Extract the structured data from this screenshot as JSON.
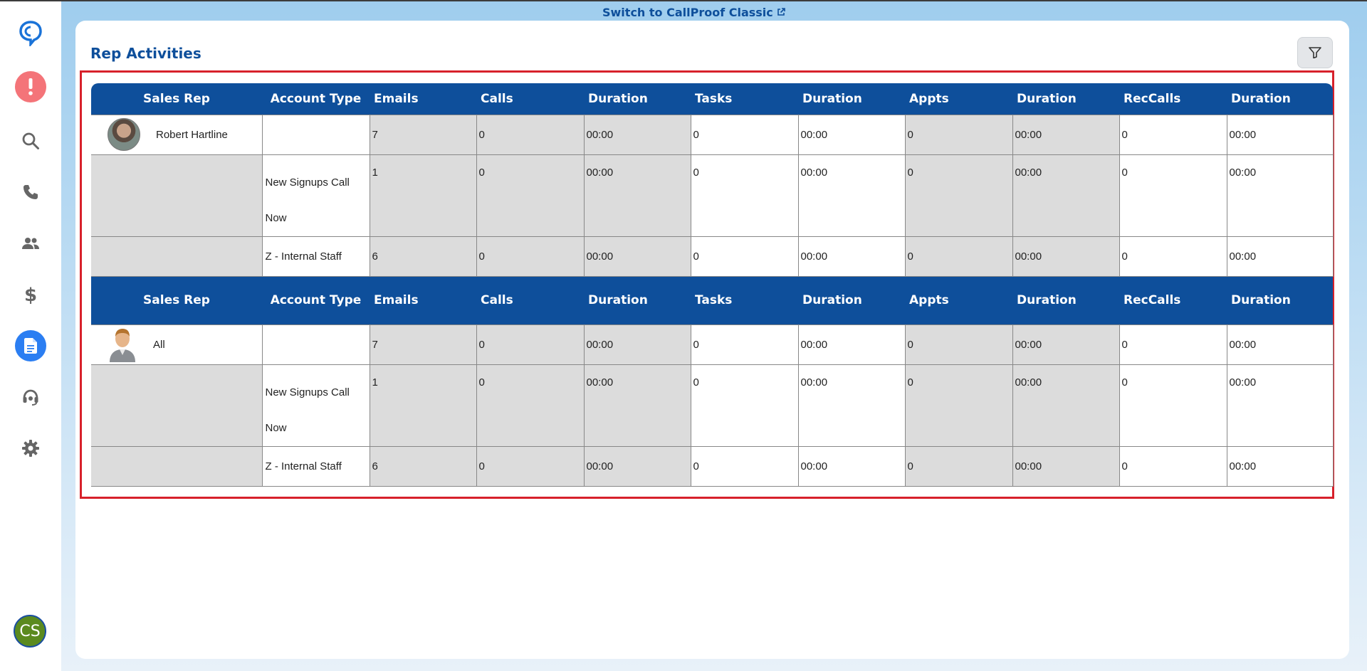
{
  "topbar": {
    "switch_label": "Switch to CallProof Classic"
  },
  "sidebar": {
    "items": [
      {
        "name": "logo",
        "icon": "callproof-logo-icon"
      },
      {
        "name": "alerts",
        "icon": "alert-icon",
        "color": "#f47479"
      },
      {
        "name": "search",
        "icon": "search-icon"
      },
      {
        "name": "calls",
        "icon": "phone-icon"
      },
      {
        "name": "contacts",
        "icon": "people-icon"
      },
      {
        "name": "sales",
        "icon": "dollar-icon"
      },
      {
        "name": "reports",
        "icon": "document-icon",
        "color": "#2b7ef2"
      },
      {
        "name": "support",
        "icon": "headset-icon"
      },
      {
        "name": "settings",
        "icon": "gear-icon"
      }
    ],
    "user_initials": "CS"
  },
  "page": {
    "title": "Rep Activities",
    "filter_icon": "filter-icon"
  },
  "table": {
    "headers": [
      "Sales Rep",
      "Account Type",
      "Emails",
      "Calls",
      "Duration",
      "Tasks",
      "Duration",
      "Appts",
      "Duration",
      "RecCalls",
      "Duration"
    ],
    "groups": [
      {
        "rep": "Robert Hartline",
        "total": [
          "7",
          "0",
          "00:00",
          "0",
          "00:00",
          "0",
          "00:00",
          "0",
          "00:00"
        ],
        "rows": [
          {
            "account": "New Signups Call Now",
            "values": [
              "1",
              "0",
              "00:00",
              "0",
              "00:00",
              "0",
              "00:00",
              "0",
              "00:00"
            ]
          },
          {
            "account": "Z - Internal Staff",
            "values": [
              "6",
              "0",
              "00:00",
              "0",
              "00:00",
              "0",
              "00:00",
              "0",
              "00:00"
            ]
          }
        ]
      },
      {
        "rep": "All",
        "total": [
          "7",
          "0",
          "00:00",
          "0",
          "00:00",
          "0",
          "00:00",
          "0",
          "00:00"
        ],
        "rows": [
          {
            "account": "New Signups Call Now",
            "values": [
              "1",
              "0",
              "00:00",
              "0",
              "00:00",
              "0",
              "00:00",
              "0",
              "00:00"
            ]
          },
          {
            "account": "Z - Internal Staff",
            "values": [
              "6",
              "0",
              "00:00",
              "0",
              "00:00",
              "0",
              "00:00",
              "0",
              "00:00"
            ]
          }
        ]
      }
    ]
  }
}
